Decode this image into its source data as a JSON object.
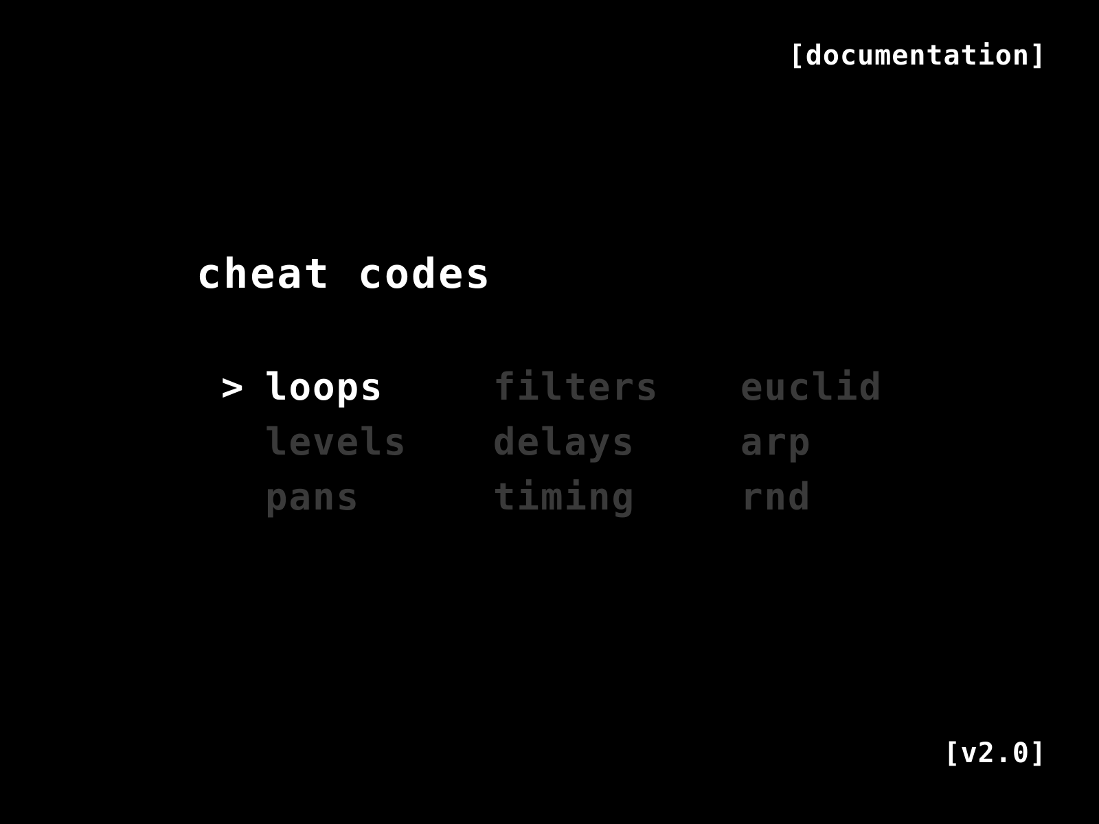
{
  "header": {
    "documentation_label": "[documentation]"
  },
  "title": "cheat codes",
  "menu": {
    "cursor_glyph": ">",
    "items": [
      {
        "label": "loops",
        "selected": true
      },
      {
        "label": "filters",
        "selected": false
      },
      {
        "label": "euclid",
        "selected": false
      },
      {
        "label": "levels",
        "selected": false
      },
      {
        "label": "delays",
        "selected": false
      },
      {
        "label": "arp",
        "selected": false
      },
      {
        "label": "pans",
        "selected": false
      },
      {
        "label": "timing",
        "selected": false
      },
      {
        "label": "rnd",
        "selected": false
      }
    ]
  },
  "footer": {
    "version_label": "[v2.0]"
  },
  "colors": {
    "background": "#000000",
    "active": "#ffffff",
    "inactive": "#3a3a3a"
  }
}
